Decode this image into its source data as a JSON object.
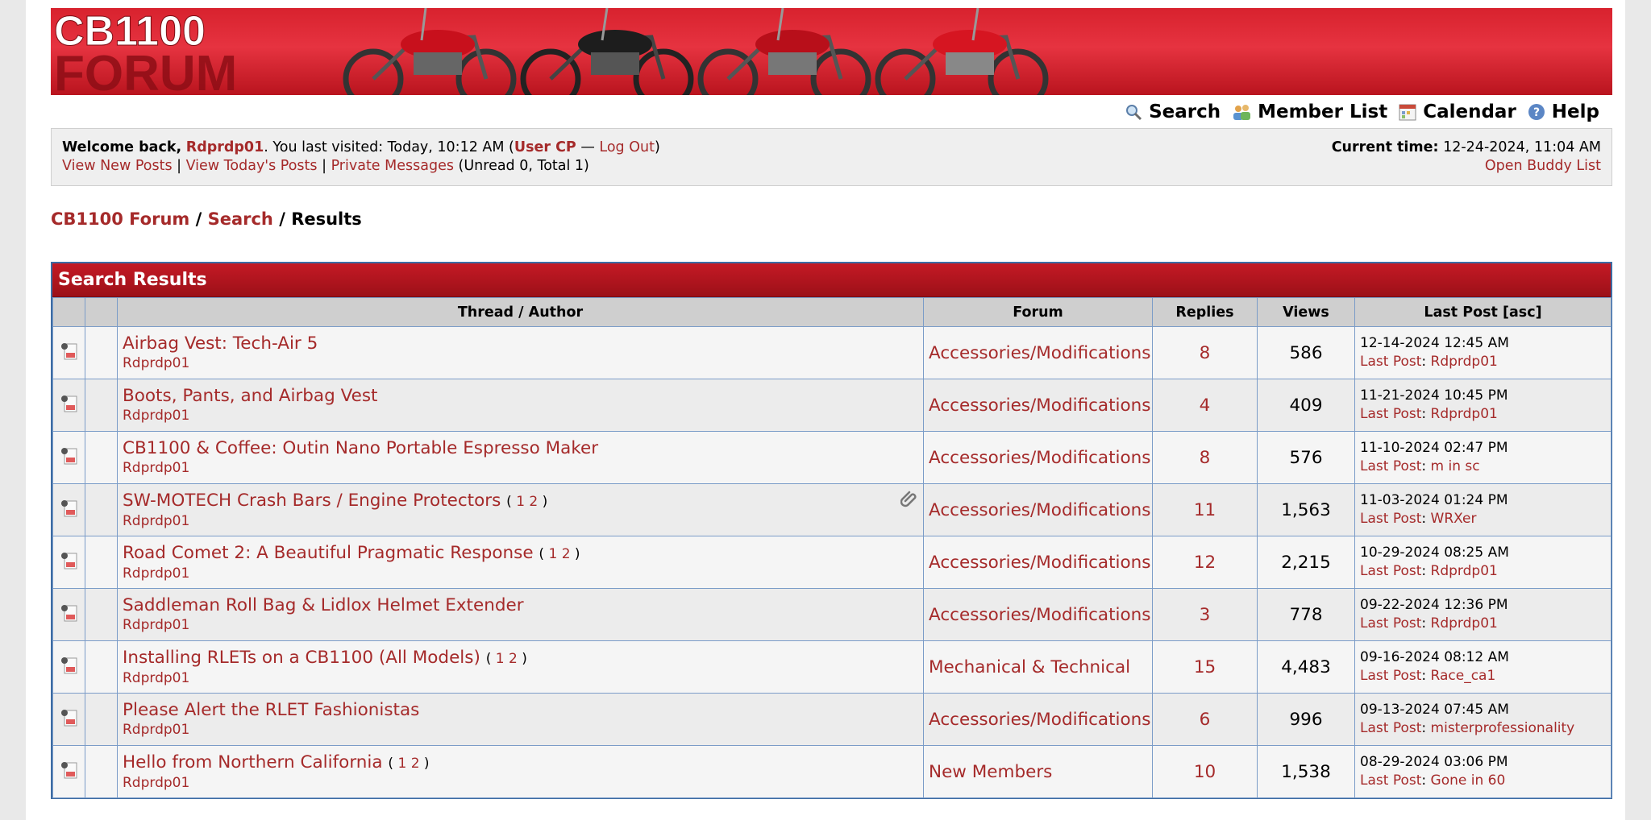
{
  "banner": {
    "logo_line1": "CB1100",
    "logo_line2": "FORUM",
    "colors": {
      "base": "#d8222e",
      "dark": "#b9141e"
    }
  },
  "toplinks": [
    {
      "label": "Search",
      "icon": "magnifier-icon"
    },
    {
      "label": "Member List",
      "icon": "members-icon"
    },
    {
      "label": "Calendar",
      "icon": "calendar-icon"
    },
    {
      "label": "Help",
      "icon": "help-icon"
    }
  ],
  "welcome": {
    "prefix": "Welcome back,",
    "username": "Rdprdp01",
    "visited_text": ". You last visited: Today, 10:12 AM (",
    "user_cp": "User CP",
    "dash": " — ",
    "logout": "Log Out",
    "close_paren": ")",
    "links": [
      "View New Posts",
      "View Today's Posts",
      "Private Messages"
    ],
    "separator": " | ",
    "pm_counts": "(Unread 0, Total 1)",
    "time_label": "Current time:",
    "time_value": "12-24-2024, 11:04 AM",
    "buddy_list": "Open Buddy List"
  },
  "breadcrumb": {
    "items": [
      "CB1100 Forum",
      "Search"
    ],
    "separator": " / ",
    "current": "Results"
  },
  "results": {
    "title": "Search Results",
    "columns": [
      "Thread / Author",
      "Forum",
      "Replies",
      "Views",
      "Last Post [asc]"
    ],
    "last_post_label": "Last Post",
    "rows": [
      {
        "title": "Airbag Vest: Tech-Air 5",
        "pages": [],
        "author": "Rdprdp01",
        "forum": "Accessories/Modifications",
        "replies": "8",
        "views": "586",
        "last_date": "12-14-2024 12:45 AM",
        "last_user": "Rdprdp01",
        "attachment": false
      },
      {
        "title": "Boots, Pants, and Airbag Vest",
        "pages": [],
        "author": "Rdprdp01",
        "forum": "Accessories/Modifications",
        "replies": "4",
        "views": "409",
        "last_date": "11-21-2024 10:45 PM",
        "last_user": "Rdprdp01",
        "attachment": false
      },
      {
        "title": "CB1100 & Coffee: Outin Nano Portable Espresso Maker",
        "pages": [],
        "author": "Rdprdp01",
        "forum": "Accessories/Modifications",
        "replies": "8",
        "views": "576",
        "last_date": "11-10-2024 02:47 PM",
        "last_user": "m in sc",
        "attachment": false
      },
      {
        "title": "SW-MOTECH Crash Bars / Engine Protectors",
        "pages": [
          "1",
          "2"
        ],
        "author": "Rdprdp01",
        "forum": "Accessories/Modifications",
        "replies": "11",
        "views": "1,563",
        "last_date": "11-03-2024 01:24 PM",
        "last_user": "WRXer",
        "attachment": true
      },
      {
        "title": "Road Comet 2: A Beautiful Pragmatic Response",
        "pages": [
          "1",
          "2"
        ],
        "author": "Rdprdp01",
        "forum": "Accessories/Modifications",
        "replies": "12",
        "views": "2,215",
        "last_date": "10-29-2024 08:25 AM",
        "last_user": "Rdprdp01",
        "attachment": false
      },
      {
        "title": "Saddleman Roll Bag & Lidlox Helmet Extender",
        "pages": [],
        "author": "Rdprdp01",
        "forum": "Accessories/Modifications",
        "replies": "3",
        "views": "778",
        "last_date": "09-22-2024 12:36 PM",
        "last_user": "Rdprdp01",
        "attachment": false
      },
      {
        "title": "Installing RLETs on a CB1100 (All Models)",
        "pages": [
          "1",
          "2"
        ],
        "author": "Rdprdp01",
        "forum": "Mechanical & Technical",
        "replies": "15",
        "views": "4,483",
        "last_date": "09-16-2024 08:12 AM",
        "last_user": "Race_ca1",
        "attachment": false
      },
      {
        "title": "Please Alert the RLET Fashionistas",
        "pages": [],
        "author": "Rdprdp01",
        "forum": "Accessories/Modifications",
        "replies": "6",
        "views": "996",
        "last_date": "09-13-2024 07:45 AM",
        "last_user": "misterprofessionality",
        "attachment": false
      },
      {
        "title": "Hello from Northern California",
        "pages": [
          "1",
          "2"
        ],
        "author": "Rdprdp01",
        "forum": "New Members",
        "replies": "10",
        "views": "1,538",
        "last_date": "08-29-2024 03:06 PM",
        "last_user": "Gone in 60",
        "attachment": false
      }
    ]
  },
  "colors": {
    "link": "#a52a2a",
    "header_red": "#c41a25",
    "border_blue": "#3d6ca3"
  }
}
